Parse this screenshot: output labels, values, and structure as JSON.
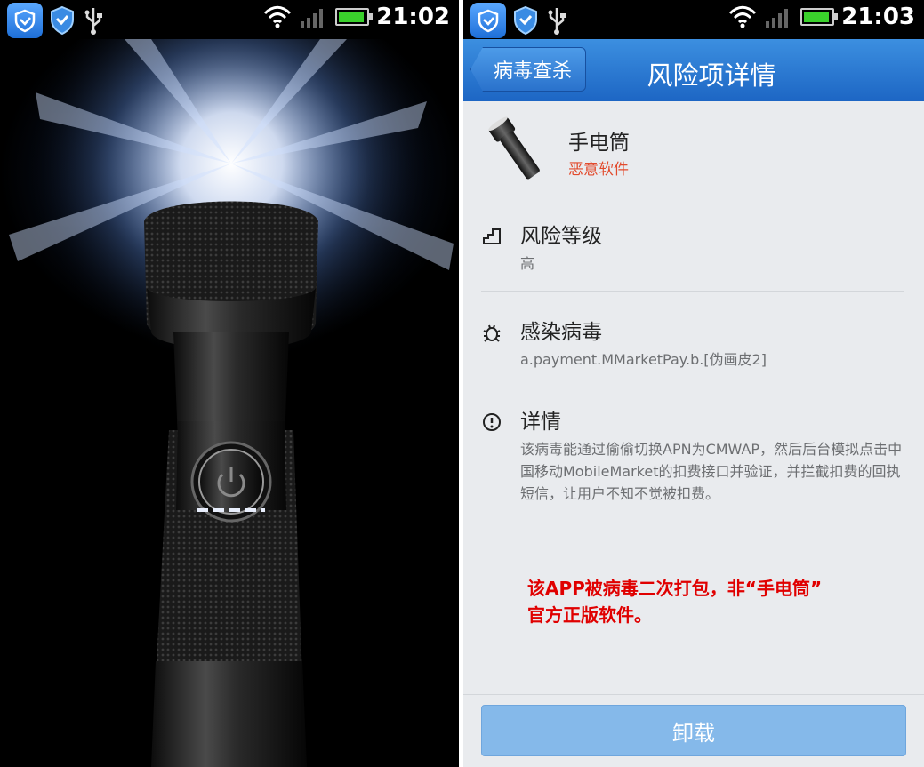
{
  "left": {
    "status": {
      "time": "21:02"
    }
  },
  "right": {
    "status": {
      "time": "21:03"
    },
    "header": {
      "back_label": "病毒查杀",
      "title": "风险项详情"
    },
    "app": {
      "name": "手电筒",
      "risk": "恶意软件"
    },
    "sections": [
      {
        "title": "风险等级",
        "value": "高",
        "icon": "stairs-icon"
      },
      {
        "title": "感染病毒",
        "value": "a.payment.MMarketPay.b.[伪画皮2]",
        "icon": "bug-icon"
      },
      {
        "title": "详情",
        "value": "该病毒能通过偷偷切换APN为CMWAP，然后后台模拟点击中国移动MobileMarket的扣费接口并验证，并拦截扣费的回执短信，让用户不知不觉被扣费。",
        "icon": "alert-icon"
      }
    ],
    "note": {
      "line1": "该APP被病毒二次打包，非“手电筒”",
      "line2": "官方正版软件。"
    },
    "uninstall_label": "卸载"
  }
}
